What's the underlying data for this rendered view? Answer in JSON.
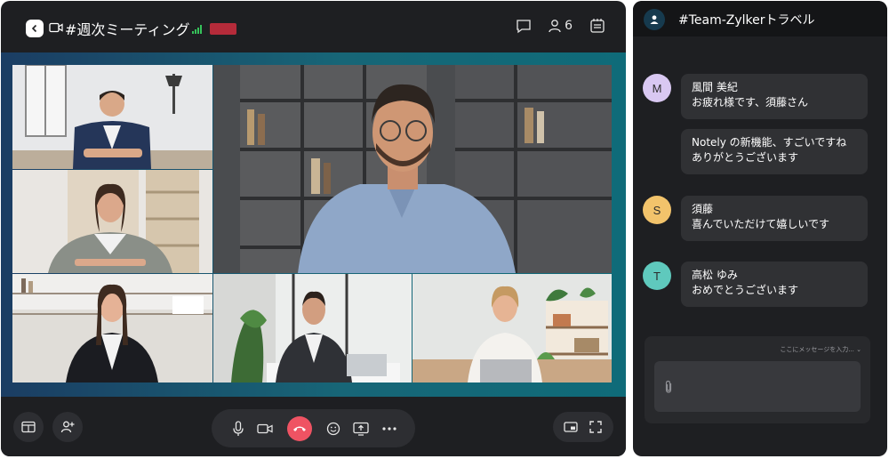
{
  "call": {
    "title": "#週次ミーティング",
    "participant_count": "6",
    "recording_color": "#b52b3a",
    "icons": [
      "back-icon",
      "video-camera-icon",
      "signal-icon",
      "chat-icon",
      "participants-icon",
      "notes-icon"
    ]
  },
  "controls": {
    "hangup_color": "#ef5363",
    "icons": [
      "layout-icon",
      "add-participant-icon",
      "microphone-icon",
      "video-camera-icon",
      "hang-up-icon",
      "emoji-icon",
      "screen-share-icon",
      "more-icon",
      "picture-in-picture-icon",
      "fullscreen-icon"
    ]
  },
  "chat": {
    "title": "#Team-Zylkerトラベル",
    "messages": [
      {
        "initial": "M",
        "avatar_color": "#d9c8f2",
        "name": "風間 美紀",
        "text": "お疲れ様です、須藤さん"
      },
      {
        "initial": "",
        "avatar_color": "",
        "name": "",
        "text1": "Notely の新機能、すごいですね",
        "text2": "ありがとうございます"
      },
      {
        "initial": "S",
        "avatar_color": "#f2c36b",
        "name": "須藤",
        "text": "喜んでいただけて嬉しいです"
      },
      {
        "initial": "T",
        "avatar_color": "#5fc9bd",
        "name": "高松 ゆみ",
        "text": "おめでとうございます"
      }
    ],
    "composer_placeholder": "ここにメッセージを入力..."
  }
}
